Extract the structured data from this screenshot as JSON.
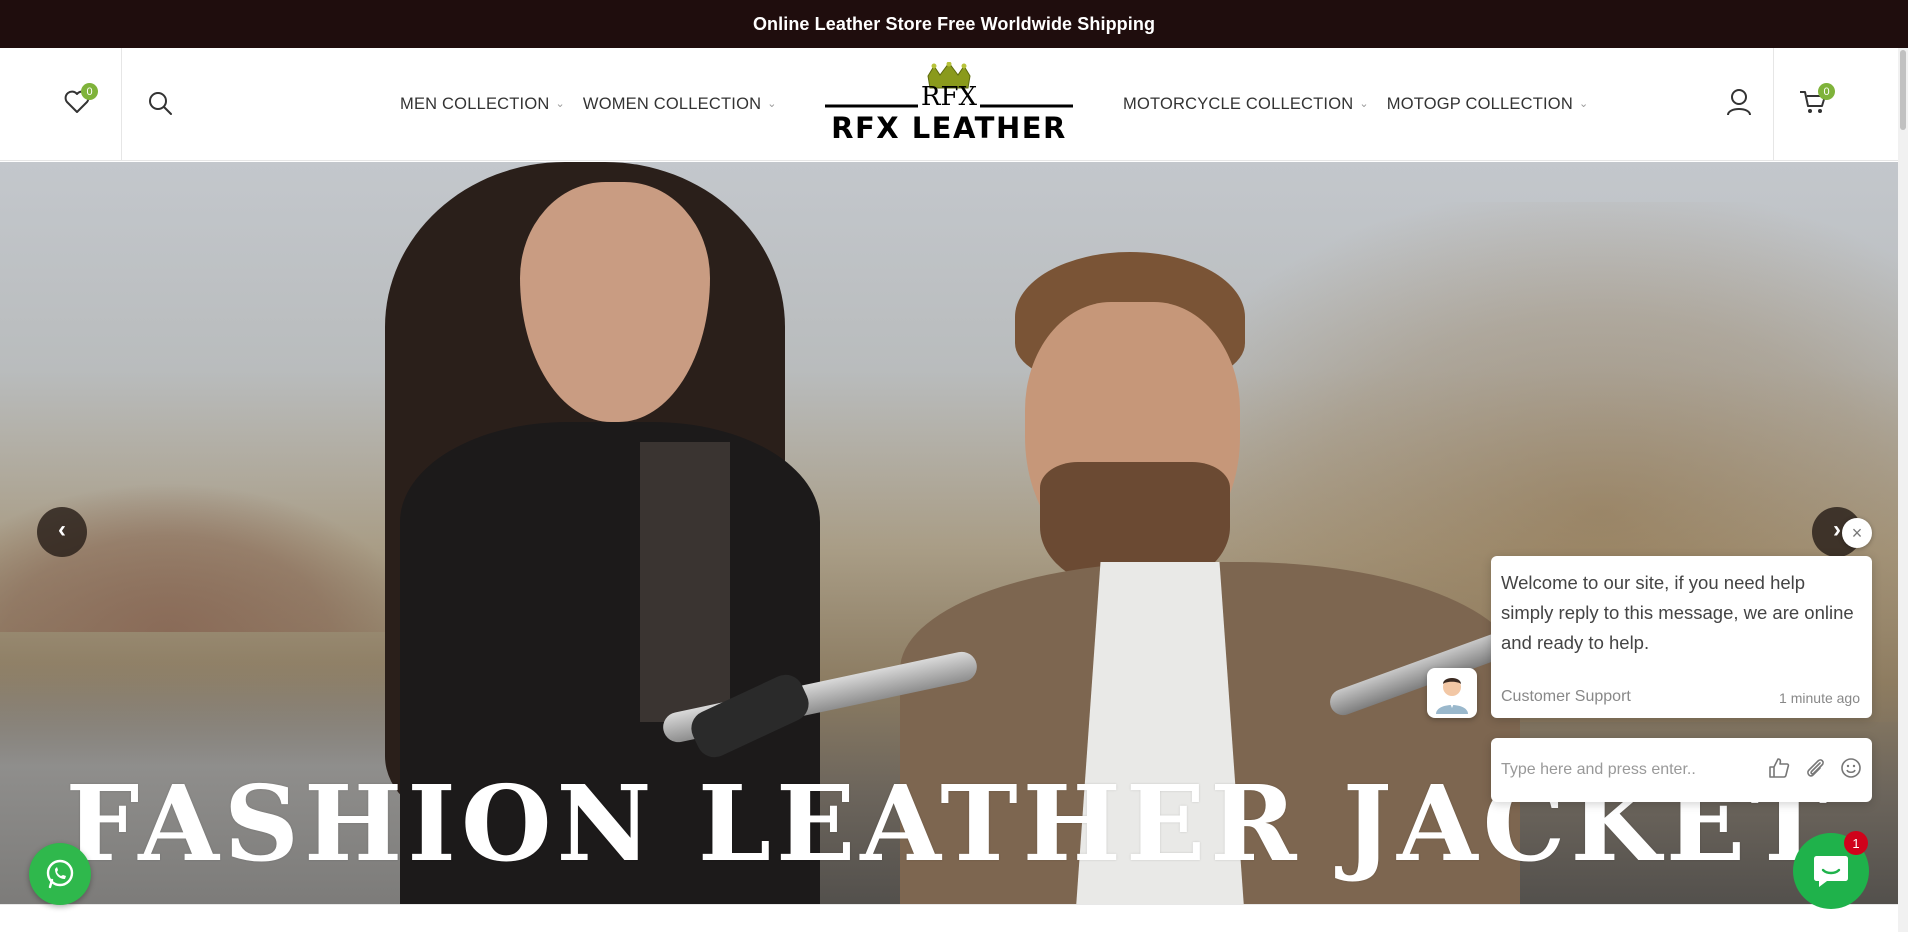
{
  "announcement": {
    "text": "Online Leather Store Free Worldwide Shipping"
  },
  "header": {
    "wishlist_count": "0",
    "cart_count": "0",
    "nav_left": [
      {
        "label": "MEN COLLECTION"
      },
      {
        "label": "WOMEN COLLECTION"
      }
    ],
    "nav_right": [
      {
        "label": "MOTORCYCLE COLLECTION"
      },
      {
        "label": "MOTOGP COLLECTION"
      }
    ],
    "logo": {
      "top_text": "RFX",
      "main_text": "RFX LEATHER"
    }
  },
  "hero": {
    "caption": "FASHION LEATHER JACKET",
    "prev_label": "‹",
    "next_label": "›"
  },
  "chat": {
    "message": "Welcome to our site, if you need help simply reply to this message, we are online and ready to help.",
    "author": "Customer Support",
    "time": "1 minute ago",
    "input_placeholder": "Type here and press enter..",
    "close_label": "×",
    "unread_count": "1"
  },
  "colors": {
    "topbar_bg": "#1f0d0d",
    "badge": "#7fb33a",
    "chat_launcher": "#1fb24b",
    "whatsapp": "#2fb84c",
    "unread_badge": "#d0021b"
  }
}
